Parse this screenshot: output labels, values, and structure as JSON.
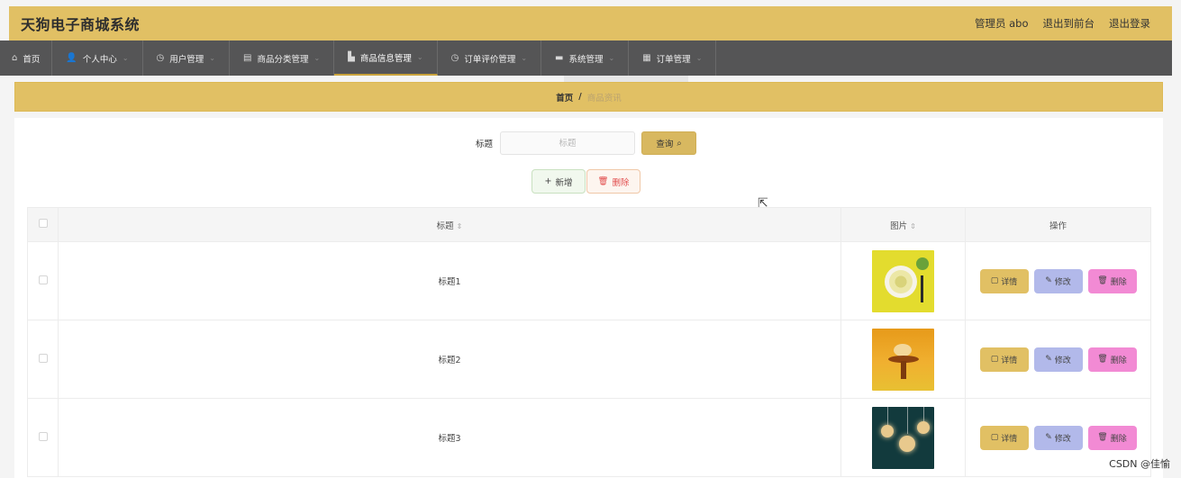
{
  "header": {
    "title": "天狗电子商城系统",
    "user_label": "管理员 abo",
    "front_label": "退出到前台",
    "logout_label": "退出登录"
  },
  "nav": {
    "items": [
      {
        "label": "首页",
        "icon": "home-icon"
      },
      {
        "label": "个人中心",
        "icon": "user-icon"
      },
      {
        "label": "用户管理",
        "icon": "clock-icon"
      },
      {
        "label": "商品分类管理",
        "icon": "doc-icon"
      },
      {
        "label": "商品信息管理",
        "icon": "chart-icon"
      },
      {
        "label": "订单评价管理",
        "icon": "clock-icon"
      },
      {
        "label": "系统管理",
        "icon": "monitor-icon"
      },
      {
        "label": "订单管理",
        "icon": "grid-icon"
      }
    ]
  },
  "breadcrumb": {
    "home": "首页",
    "separator": "/",
    "current": "商品资讯"
  },
  "search": {
    "label": "标题",
    "placeholder": "标题",
    "button": "查询"
  },
  "actions": {
    "add": "新增",
    "delete": "删除"
  },
  "table": {
    "columns": {
      "title": "标题",
      "image": "图片",
      "ops": "操作"
    },
    "rows": [
      {
        "title": "标题1"
      },
      {
        "title": "标题2"
      },
      {
        "title": "标题3"
      }
    ],
    "row_buttons": {
      "detail": "详情",
      "edit": "修改",
      "delete": "删除"
    }
  },
  "watermark": "CSDN @佳愉",
  "colors": {
    "header_bg": "#e1c064",
    "nav_bg": "#555556",
    "detail_btn": "#e1c064",
    "edit_btn": "#b2b9ea",
    "delete_btn": "#f28ad4"
  }
}
